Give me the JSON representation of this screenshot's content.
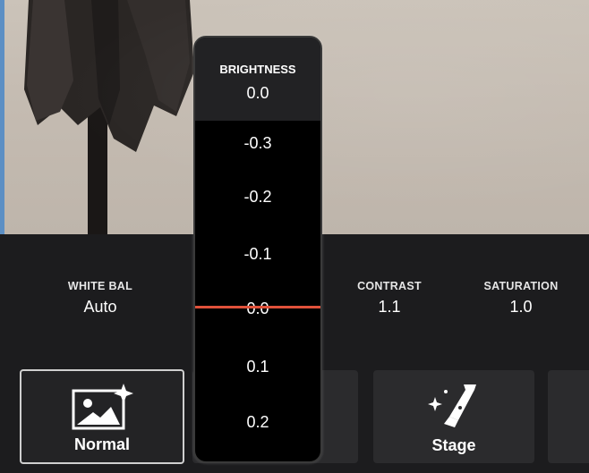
{
  "slider": {
    "label": "BRIGHTNESS",
    "value": "0.0",
    "ticks": [
      "-0.3",
      "-0.2",
      "-0.1",
      "0.0",
      "0.1",
      "0.2"
    ],
    "indicator_color": "#e0513a"
  },
  "params": {
    "white_balance": {
      "label": "WHITE BAL",
      "value": "Auto"
    },
    "contrast": {
      "label": "CONTRAST",
      "value": "1.1"
    },
    "saturation": {
      "label": "SATURATION",
      "value": "1.0"
    }
  },
  "presets": {
    "normal": {
      "label": "Normal",
      "icon": "image-sparkle-icon",
      "selected": true
    },
    "stage": {
      "label": "Stage",
      "icon": "spotlight-icon",
      "selected": false
    }
  }
}
